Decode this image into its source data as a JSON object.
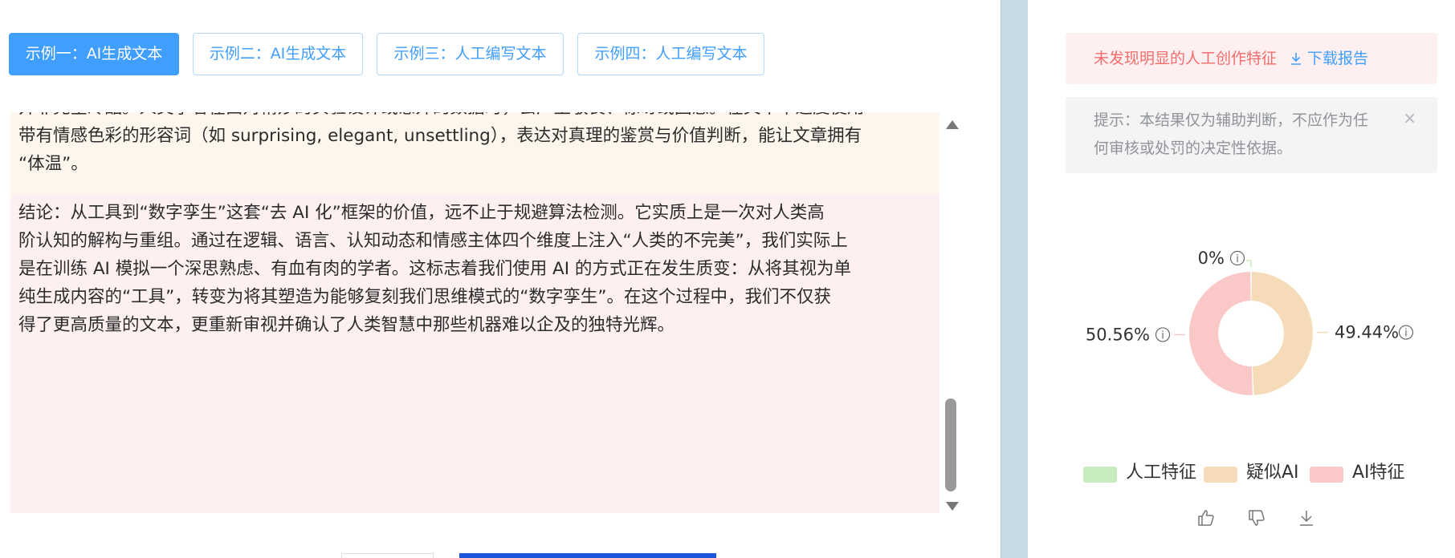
{
  "tabs": [
    {
      "label": "示例一：AI生成文本",
      "active": true
    },
    {
      "label": "示例二：AI生成文本",
      "active": false
    },
    {
      "label": "示例三：人工编写文本",
      "active": false
    },
    {
      "label": "示例四：人工编写文本",
      "active": false
    }
  ],
  "text": {
    "paragraph_yellow_lines": [
      "并非完全冷酷。人类学者在面对精妙的实验设计或意外的数据时，会产生敬畏、惊讶或困惑。在文本中适度使用",
      "带有情感色彩的形容词（如 surprising, elegant, unsettling），表达对真理的鉴赏与价值判断，能让文章拥有",
      "“体温”。"
    ],
    "paragraph_pink_lines": [
      "结论：从工具到“数字孪生”这套“去 AI 化”框架的价值，远不止于规避算法检测。它实质上是一次对人类高",
      "阶认知的解构与重组。通过在逻辑、语言、认知动态和情感主体四个维度上注入“人类的不完美”，我们实际上",
      "是在训练 AI 模拟一个深思熟虑、有血有肉的学者。这标志着我们使用 AI 的方式正在发生质变：从将其视为单",
      "纯生成内容的“工具”，转变为将其塑造为能够复刻我们思维模式的“数字孪生”。在这个过程中，我们不仅获",
      "得了更高质量的文本，更重新审视并确认了人类智慧中那些机器难以企及的独特光辉。"
    ]
  },
  "result": {
    "message": "未发现明显的人工创作特征",
    "download_label": "下载报告",
    "tip_lines": [
      "提示：本结果仅为辅助判断，不应作为任",
      "何审核或处罚的决定性依据。"
    ],
    "close_symbol": "×"
  },
  "chart_data": {
    "type": "pie",
    "donut": true,
    "labels": [
      "人工特征",
      "疑似AI",
      "AI特征"
    ],
    "values": [
      0,
      49.44,
      50.56
    ],
    "display_labels": [
      "0%",
      "49.44%",
      "50.56%"
    ],
    "colors": [
      "#c8ecc0",
      "#f5dbb8",
      "#fbc8c8"
    ],
    "legend_position": "bottom"
  },
  "actions": {
    "like_icon": "thumbs-up-icon",
    "dislike_icon": "thumbs-down-icon",
    "download_icon": "download-icon"
  },
  "colors": {
    "primary": "#409eff",
    "danger": "#f56c6c",
    "warning_bg": "#fdf6ec",
    "danger_bg": "#fef0f0"
  }
}
